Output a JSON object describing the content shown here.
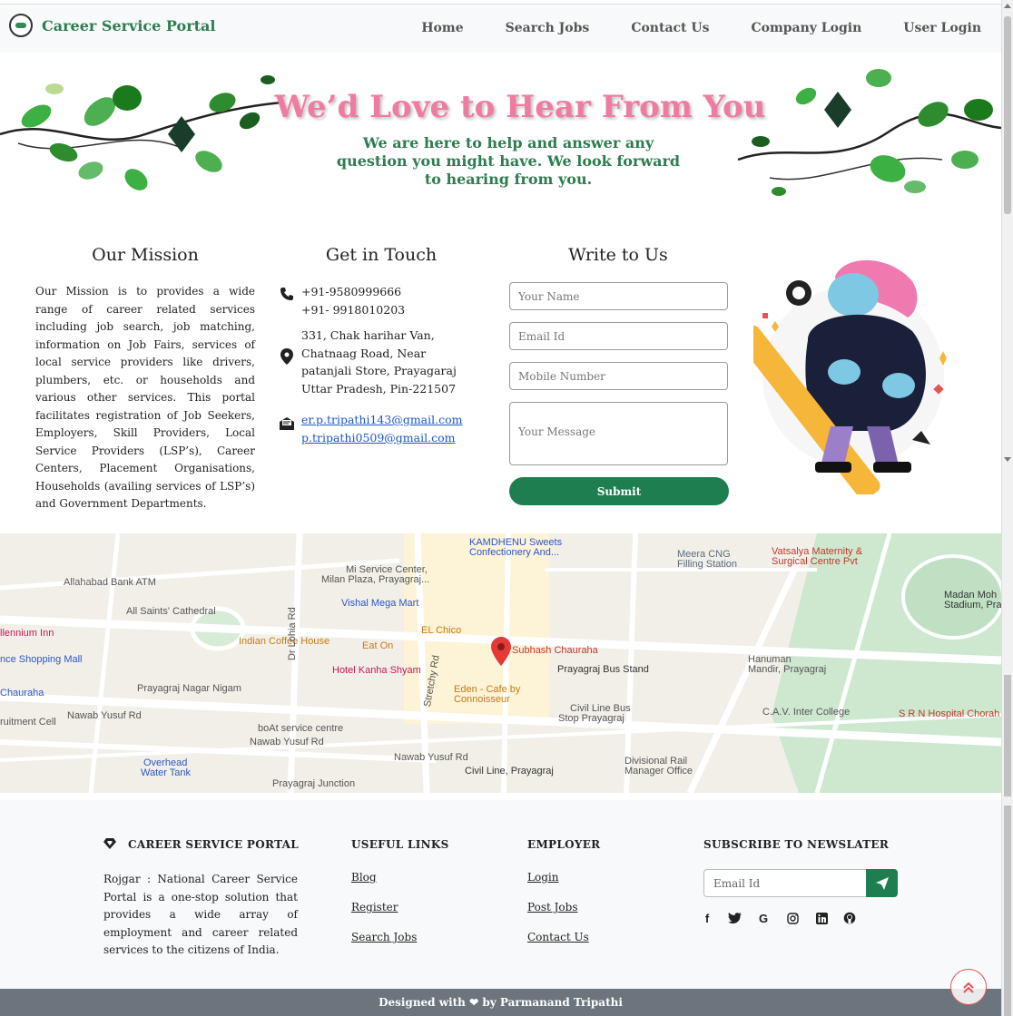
{
  "nav": {
    "brand": "Career Service Portal",
    "links": [
      "Home",
      "Search Jobs",
      "Contact Us",
      "Company Login",
      "User Login"
    ]
  },
  "hero": {
    "title": "We’d Love to Hear From You",
    "subtitle": "We are here to help and answer any question you might have. We look forward to hearing from you."
  },
  "mission": {
    "title": "Our Mission",
    "text": "Our Mission is to provides a wide range of career related services including job search, job matching, information on Job Fairs, services of local service providers like drivers, plumbers, etc. or households and various other services. This portal facilitates registration of Job Seekers, Employers, Skill Providers, Local Service Providers (LSP’s), Career Centers, Placement Organisations, Households (availing services of LSP’s) and Government Departments."
  },
  "contact": {
    "title": "Get in Touch",
    "phone1": "+91-9580999666",
    "phone2": "+91- 9918010203",
    "address": "331, Chak harihar Van, Chatnaag Road, Near patanjali Store, Prayagaraj Uttar Pradesh, Pin-221507",
    "email1": "er.p.tripathi143@gmail.com",
    "email2": "p.tripathi0509@gmail.com"
  },
  "form": {
    "title": "Write to Us",
    "name_placeholder": "Your Name",
    "email_placeholder": "Email Id",
    "mobile_placeholder": "Mobile Number",
    "message_placeholder": "Your Message",
    "submit_label": "Submit"
  },
  "map": {
    "labels": [
      {
        "text": "KAMDHENU Sweets",
        "color": "#2a56c6"
      },
      {
        "text": "Confectionery And...",
        "color": "#2a56c6"
      },
      {
        "text": "Meera CNG",
        "color": "#5a6c7e"
      },
      {
        "text": "Filling Station",
        "color": "#5a6c7e"
      },
      {
        "text": "Vatsalya Maternity &",
        "color": "#c0392b"
      },
      {
        "text": "Surgical Centre Pvt",
        "color": "#c0392b"
      },
      {
        "text": "Mi Service Center,",
        "color": "#555"
      },
      {
        "text": "Milan Plaza, Prayagraj...",
        "color": "#555"
      },
      {
        "text": "Allahabad Bank ATM",
        "color": "#555"
      },
      {
        "text": "Vishal Mega Mart",
        "color": "#2a56c6"
      },
      {
        "text": "All Saints' Cathedral",
        "color": "#555"
      },
      {
        "text": "EL Chico",
        "color": "#c77a12"
      },
      {
        "text": "Indian Coffee House",
        "color": "#c77a12"
      },
      {
        "text": "Eat On",
        "color": "#c77a12"
      },
      {
        "text": "Subhash Chauraha",
        "color": "#c0392b"
      },
      {
        "text": "Hotel Kanha Shyam",
        "color": "#c2185b"
      },
      {
        "text": "Prayagraj Bus Stand",
        "color": "#333"
      },
      {
        "text": "Hanuman",
        "color": "#555"
      },
      {
        "text": "Mandir, Prayagraj",
        "color": "#555"
      },
      {
        "text": "Prayagraj Nagar Nigam",
        "color": "#555"
      },
      {
        "text": "Eden - Cafe by",
        "color": "#c77a12"
      },
      {
        "text": "Connoisseur",
        "color": "#c77a12"
      },
      {
        "text": "Civil Line Bus",
        "color": "#555"
      },
      {
        "text": "Stop Prayagraj",
        "color": "#555"
      },
      {
        "text": "C.A.V. Inter College",
        "color": "#555"
      },
      {
        "text": "S R N Hospital Chorah",
        "color": "#c0392b"
      },
      {
        "text": "boAt service centre",
        "color": "#555"
      },
      {
        "text": "Divisional Rail",
        "color": "#555"
      },
      {
        "text": "Manager Office",
        "color": "#555"
      },
      {
        "text": "Civil Line, Prayagraj",
        "color": "#333"
      },
      {
        "text": "Prayagraj Junction",
        "color": "#555"
      },
      {
        "text": "Madan Moh",
        "color": "#333"
      },
      {
        "text": "Stadium, Pra",
        "color": "#333"
      },
      {
        "text": "Nawab Yusuf Rd",
        "color": "#555"
      },
      {
        "text": "Nawab Yusuf Rd",
        "color": "#555"
      },
      {
        "text": "Nawab Yusuf Rd",
        "color": "#555"
      },
      {
        "text": "Overhead",
        "color": "#2a56c6"
      },
      {
        "text": "Water Tank",
        "color": "#2a56c6"
      },
      {
        "text": "Dr Lohia Rd",
        "color": "#555"
      },
      {
        "text": "Stretchy Rd",
        "color": "#555"
      },
      {
        "text": "llennium Inn",
        "color": "#c2185b"
      },
      {
        "text": "nce Shopping Mall",
        "color": "#2a56c6"
      },
      {
        "text": "Chauraha",
        "color": "#2a56c6"
      },
      {
        "text": "ruitment Cell",
        "color": "#555"
      }
    ]
  },
  "footer": {
    "brand_title": "CAREER SERVICE PORTAL",
    "about": "Rojgar : National Career Service Portal is a one-stop solution that provides a wide array of employment and career related services to the citizens of India.",
    "useful_title": "USEFUL LINKS",
    "useful_links": [
      "Blog",
      "Register",
      "Search Jobs"
    ],
    "employer_title": "EMPLOYER",
    "employer_links": [
      "Login",
      "Post Jobs",
      "Contact Us"
    ],
    "newsletter_title": "SUBSCRIBE TO NEWSLATER",
    "newsletter_placeholder": "Email Id",
    "social": [
      "facebook-icon",
      "twitter-icon",
      "google-icon",
      "instagram-icon",
      "linkedin-icon",
      "github-icon"
    ],
    "credit_prefix": "Designed with",
    "credit_suffix": "by Parmanand Tripathi"
  },
  "colors": {
    "brand_green": "#1e7e4f",
    "hero_pink": "#ef7ca0",
    "link_blue": "#1a56c9",
    "bottom_bar": "#6c757d"
  }
}
